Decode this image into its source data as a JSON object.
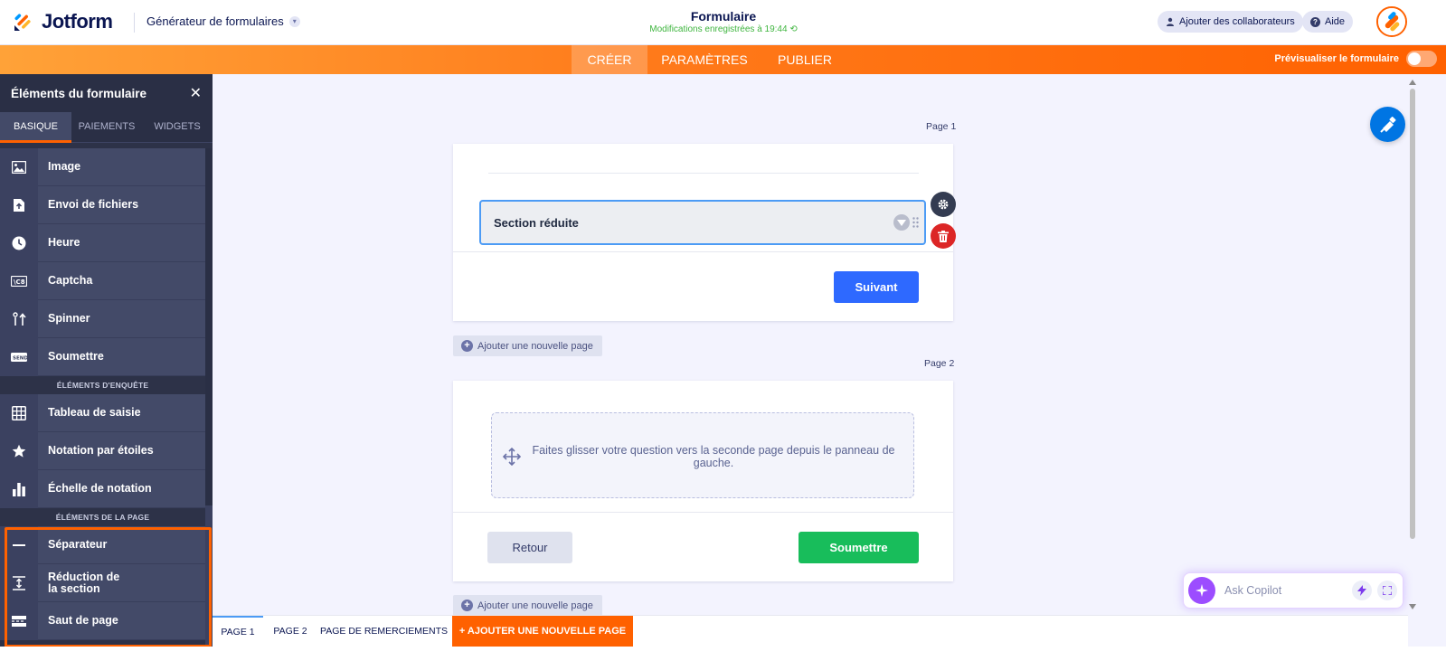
{
  "header": {
    "logo_text": "Jotform",
    "builder_dropdown": "Générateur de formulaires",
    "form_title": "Formulaire",
    "saved_status": "Modifications enregistrées à 19:44",
    "collaborators_label": "Ajouter des collaborateurs",
    "help_label": "Aide"
  },
  "nav": {
    "tabs": [
      "CRÉER",
      "PARAMÈTRES",
      "PUBLIER"
    ],
    "active_tab": "CRÉER",
    "preview_label": "Prévisualiser le formulaire",
    "preview_enabled": false
  },
  "left_panel": {
    "title": "Éléments du formulaire",
    "tabs": [
      "BASIQUE",
      "PAIEMENTS",
      "WIDGETS"
    ],
    "active_tab": "BASIQUE",
    "items_basic": [
      {
        "label": "Image",
        "icon": "image-icon"
      },
      {
        "label": "Envoi de fichiers",
        "icon": "file-upload-icon"
      },
      {
        "label": "Heure",
        "icon": "clock-icon"
      },
      {
        "label": "Captcha",
        "icon": "captcha-icon"
      },
      {
        "label": "Spinner",
        "icon": "spinner-icon"
      },
      {
        "label": "Soumettre",
        "icon": "send-icon"
      }
    ],
    "section_survey": "ÉLÉMENTS D'ENQUÊTE",
    "items_survey": [
      {
        "label": "Tableau de saisie",
        "icon": "table-icon"
      },
      {
        "label": "Notation par étoiles",
        "icon": "star-icon"
      },
      {
        "label": "Échelle de notation",
        "icon": "bar-chart-icon"
      }
    ],
    "section_page": "ÉLÉMENTS DE LA PAGE",
    "items_page": [
      {
        "label": "Séparateur",
        "icon": "divider-icon"
      },
      {
        "label": "Réduction de la section",
        "icon": "collapse-icon"
      },
      {
        "label": "Saut de page",
        "icon": "page-break-icon"
      }
    ]
  },
  "canvas": {
    "page1": {
      "label": "Page 1",
      "collapse_field": "Section réduite",
      "next_button": "Suivant",
      "add_page": "Ajouter une nouvelle page"
    },
    "page2": {
      "label": "Page 2",
      "drop_hint": "Faites glisser votre question vers la seconde page depuis le panneau de gauche.",
      "back_button": "Retour",
      "submit_button": "Soumettre",
      "add_page": "Ajouter une nouvelle page"
    }
  },
  "bottom_bar": {
    "tabs": [
      "PAGE 1",
      "PAGE 2",
      "PAGE DE REMERCIEMENTS"
    ],
    "active_tab": "PAGE 1",
    "add_page": "+ AJOUTER UNE NOUVELLE PAGE"
  },
  "copilot": {
    "placeholder": "Ask Copilot"
  },
  "colors": {
    "brand_orange": "#ff6100",
    "panel_bg": "#2d3248",
    "next_button": "#2e69ff",
    "submit_button": "#18bd5b",
    "delete_button": "#dc2626",
    "saved_text": "#3fb53f"
  }
}
